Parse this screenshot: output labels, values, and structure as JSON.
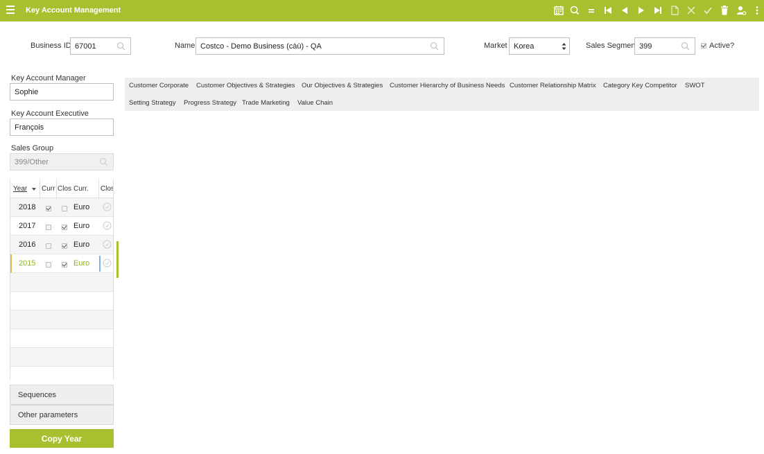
{
  "app": {
    "title": "Key Account Management"
  },
  "colors": {
    "accent": "#a8c030"
  },
  "toolbar_icons": [
    "calendar-icon",
    "search-icon",
    "equals-icon",
    "first-icon",
    "prev-icon",
    "next-icon",
    "last-icon",
    "new-doc-icon",
    "cancel-icon",
    "confirm-icon",
    "delete-icon",
    "user-settings-icon",
    "more-icon"
  ],
  "header": {
    "business_id_label": "Business ID",
    "business_id": "67001",
    "name_label": "Name",
    "name": "Costco - Demo Business (càù) - QA",
    "market_label": "Market",
    "market": "Korea",
    "sales_segment_label": "Sales Segment",
    "sales_segment": "399",
    "active_label": "Active?",
    "active": true
  },
  "left": {
    "kam_label": "Key Account Manager",
    "kam": "Sophie",
    "kae_label": "Key Account Executive",
    "kae": "François",
    "sales_group_label": "Sales Group",
    "sales_group": "399/Other"
  },
  "grid": {
    "columns": [
      "Year",
      "Curr",
      "Clos",
      "Curr.",
      "Clos"
    ],
    "rows": [
      {
        "year": "2018",
        "current": true,
        "closed": false,
        "currency": "Euro"
      },
      {
        "year": "2017",
        "current": false,
        "closed": true,
        "currency": "Euro"
      },
      {
        "year": "2016",
        "current": false,
        "closed": true,
        "currency": "Euro"
      },
      {
        "year": "2015",
        "current": false,
        "closed": true,
        "currency": "Euro",
        "selected": true
      }
    ]
  },
  "buttons": {
    "sequences": "Sequences",
    "other_parameters": "Other parameters",
    "copy_year": "Copy Year"
  },
  "tabs_row1": [
    "Customer Corporate",
    "Customer Objectives & Strategies",
    "Our Objectives & Strategies",
    "Customer Hierarchy of Business Needs",
    "Customer Relationship Matrix",
    "Category Key Competitor",
    "SWOT"
  ],
  "tabs_row2": [
    "Setting Strategy",
    "Progress Strategy",
    "Trade Marketing",
    "Value Chain"
  ]
}
